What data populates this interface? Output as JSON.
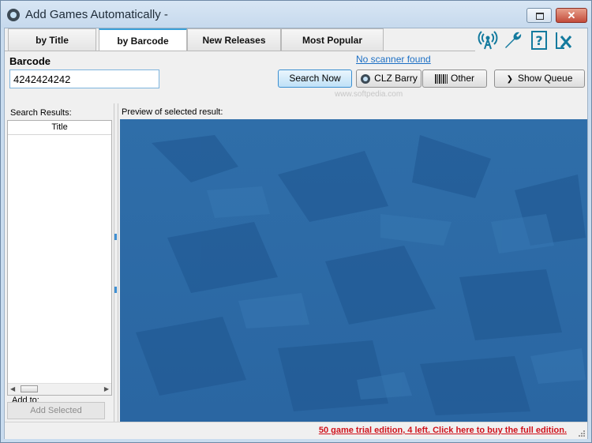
{
  "window": {
    "title": "Add Games Automatically -",
    "buttons": {
      "minimize": "minimize-icon",
      "close": "✕"
    }
  },
  "tabs": [
    {
      "label": "by Title",
      "active": false
    },
    {
      "label": "by Barcode",
      "active": true
    },
    {
      "label": "New Releases",
      "active": false
    },
    {
      "label": "Most Popular",
      "active": false
    }
  ],
  "toolbar_icons": [
    "antenna-icon",
    "wrench-icon",
    "help-icon",
    "close-panel-icon"
  ],
  "barcode": {
    "label": "Barcode",
    "value": "4242424242"
  },
  "scanner_status": "No scanner found",
  "buttons": {
    "search_now": "Search Now",
    "clz_barry": "CLZ Barry",
    "other": "Other",
    "show_queue": "Show Queue"
  },
  "watermark": "www.softpedia.com",
  "results": {
    "label": "Search Results:",
    "column_header": "Title",
    "rows": []
  },
  "add_to": {
    "label": "Add to:",
    "button": "Add Selected"
  },
  "preview": {
    "label": "Preview of selected result:"
  },
  "status_bar": {
    "trial_text": "50 game trial edition, 4 left. Click here to buy the full edition."
  },
  "colors": {
    "accent": "#3aa0d8",
    "icon_teal": "#137a9e",
    "preview_bg": "#2d6aa6",
    "trial_red": "#d0121b"
  }
}
